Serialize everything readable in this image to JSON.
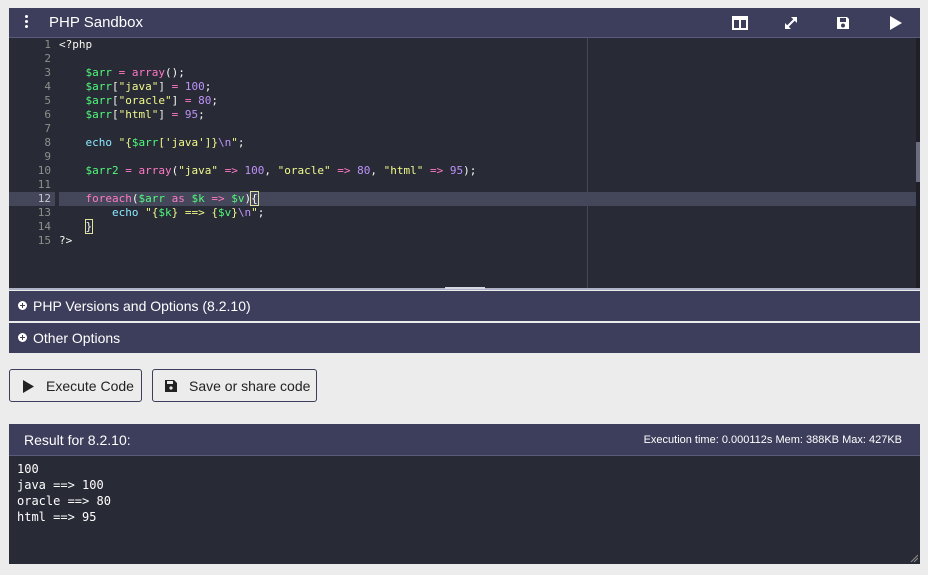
{
  "app": {
    "title": "PHP Sandbox",
    "toolbar": {
      "menu_icon": "kebab-menu-icon",
      "split_icon": "split-view-icon",
      "expand_icon": "expand-icon",
      "save_icon": "floppy-disk-icon",
      "run_icon": "play-icon"
    }
  },
  "editor": {
    "line_numbers": [
      "1",
      "2",
      "3",
      "4",
      "5",
      "6",
      "7",
      "8",
      "9",
      "10",
      "11",
      "12",
      "13",
      "14",
      "15"
    ],
    "active_line": 12,
    "lines": [
      [
        {
          "c": "t",
          "x": "<?php"
        }
      ],
      [],
      [
        {
          "c": "t",
          "x": "    "
        },
        {
          "c": "v",
          "x": "$arr"
        },
        {
          "c": "t",
          "x": " "
        },
        {
          "c": "k",
          "x": "="
        },
        {
          "c": "t",
          "x": " "
        },
        {
          "c": "k",
          "x": "array"
        },
        {
          "c": "t",
          "x": "();"
        }
      ],
      [
        {
          "c": "t",
          "x": "    "
        },
        {
          "c": "v",
          "x": "$arr"
        },
        {
          "c": "t",
          "x": "["
        },
        {
          "c": "s",
          "x": "\"java\""
        },
        {
          "c": "t",
          "x": "] "
        },
        {
          "c": "k",
          "x": "="
        },
        {
          "c": "t",
          "x": " "
        },
        {
          "c": "n",
          "x": "100"
        },
        {
          "c": "t",
          "x": ";"
        }
      ],
      [
        {
          "c": "t",
          "x": "    "
        },
        {
          "c": "v",
          "x": "$arr"
        },
        {
          "c": "t",
          "x": "["
        },
        {
          "c": "s",
          "x": "\"oracle\""
        },
        {
          "c": "t",
          "x": "] "
        },
        {
          "c": "k",
          "x": "="
        },
        {
          "c": "t",
          "x": " "
        },
        {
          "c": "n",
          "x": "80"
        },
        {
          "c": "t",
          "x": ";"
        }
      ],
      [
        {
          "c": "t",
          "x": "    "
        },
        {
          "c": "v",
          "x": "$arr"
        },
        {
          "c": "t",
          "x": "["
        },
        {
          "c": "s",
          "x": "\"html\""
        },
        {
          "c": "t",
          "x": "] "
        },
        {
          "c": "k",
          "x": "="
        },
        {
          "c": "t",
          "x": " "
        },
        {
          "c": "n",
          "x": "95"
        },
        {
          "c": "t",
          "x": ";"
        }
      ],
      [],
      [
        {
          "c": "t",
          "x": "    "
        },
        {
          "c": "e",
          "x": "echo"
        },
        {
          "c": "t",
          "x": " "
        },
        {
          "c": "s",
          "x": "\"{"
        },
        {
          "c": "v",
          "x": "$arr"
        },
        {
          "c": "s",
          "x": "['java']}"
        },
        {
          "c": "n",
          "x": "\\n"
        },
        {
          "c": "s",
          "x": "\""
        },
        {
          "c": "t",
          "x": ";"
        }
      ],
      [],
      [
        {
          "c": "t",
          "x": "    "
        },
        {
          "c": "v",
          "x": "$arr2"
        },
        {
          "c": "t",
          "x": " "
        },
        {
          "c": "k",
          "x": "="
        },
        {
          "c": "t",
          "x": " "
        },
        {
          "c": "k",
          "x": "array"
        },
        {
          "c": "t",
          "x": "("
        },
        {
          "c": "s",
          "x": "\"java\""
        },
        {
          "c": "t",
          "x": " "
        },
        {
          "c": "k",
          "x": "=>"
        },
        {
          "c": "t",
          "x": " "
        },
        {
          "c": "n",
          "x": "100"
        },
        {
          "c": "t",
          "x": ", "
        },
        {
          "c": "s",
          "x": "\"oracle\""
        },
        {
          "c": "t",
          "x": " "
        },
        {
          "c": "k",
          "x": "=>"
        },
        {
          "c": "t",
          "x": " "
        },
        {
          "c": "n",
          "x": "80"
        },
        {
          "c": "t",
          "x": ", "
        },
        {
          "c": "s",
          "x": "\"html\""
        },
        {
          "c": "t",
          "x": " "
        },
        {
          "c": "k",
          "x": "=>"
        },
        {
          "c": "t",
          "x": " "
        },
        {
          "c": "n",
          "x": "95"
        },
        {
          "c": "t",
          "x": ");"
        }
      ],
      [],
      [
        {
          "c": "t",
          "x": "    "
        },
        {
          "c": "k",
          "x": "foreach"
        },
        {
          "c": "t",
          "x": "("
        },
        {
          "c": "v",
          "x": "$arr"
        },
        {
          "c": "t",
          "x": " "
        },
        {
          "c": "k",
          "x": "as"
        },
        {
          "c": "t",
          "x": " "
        },
        {
          "c": "v",
          "x": "$k"
        },
        {
          "c": "t",
          "x": " "
        },
        {
          "c": "k",
          "x": "=>"
        },
        {
          "c": "t",
          "x": " "
        },
        {
          "c": "v",
          "x": "$v"
        },
        {
          "c": "t",
          "x": ")"
        },
        {
          "c": "b",
          "x": "{"
        }
      ],
      [
        {
          "c": "t",
          "x": "        "
        },
        {
          "c": "e",
          "x": "echo"
        },
        {
          "c": "t",
          "x": " "
        },
        {
          "c": "s",
          "x": "\"{"
        },
        {
          "c": "v",
          "x": "$k"
        },
        {
          "c": "s",
          "x": "} ==> {"
        },
        {
          "c": "v",
          "x": "$v"
        },
        {
          "c": "s",
          "x": "}"
        },
        {
          "c": "n",
          "x": "\\n"
        },
        {
          "c": "s",
          "x": "\""
        },
        {
          "c": "t",
          "x": ";"
        }
      ],
      [
        {
          "c": "t",
          "x": "    "
        },
        {
          "c": "b",
          "x": "}"
        }
      ],
      [
        {
          "c": "t",
          "x": "?>"
        }
      ]
    ]
  },
  "sections": {
    "versions_label": "PHP Versions and Options (8.2.10)",
    "other_label": "Other Options",
    "expand_icon": "plus-circle-icon"
  },
  "buttons": {
    "execute_label": "Execute Code",
    "save_label": "Save or share code"
  },
  "result": {
    "title": "Result for 8.2.10:",
    "stats": "Execution time: 0.000112s Mem: 388KB Max: 427KB",
    "output_lines": [
      "100",
      "java ==> 100",
      "oracle ==> 80",
      "html ==> 95"
    ]
  },
  "colors": {
    "header": "#3d3d5c",
    "editor_bg": "#282a36",
    "keyword": "#ff79c6",
    "variable": "#50fa7b",
    "string": "#f1fa8c",
    "number": "#bd93f9",
    "builtin": "#8be9fd"
  }
}
